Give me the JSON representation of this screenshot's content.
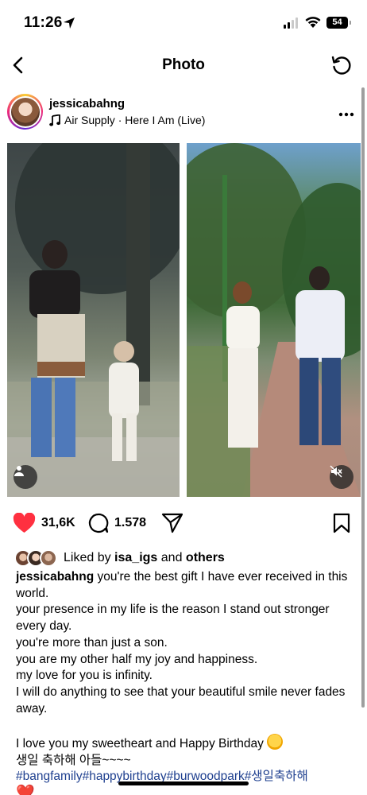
{
  "status_bar": {
    "time": "11:26",
    "battery": "54"
  },
  "nav": {
    "title": "Photo"
  },
  "post": {
    "username": "jessicabahng",
    "song": "Air Supply · Here I Am (Live)"
  },
  "actions": {
    "likes_count": "31,6K",
    "comments_count": "1.578"
  },
  "liked_by": {
    "prefix": "Liked by",
    "user": "isa_igs",
    "conj": "and",
    "others": "others"
  },
  "caption": {
    "username": "jessicabahng",
    "line1": " you're the best gift I have ever received in this world.",
    "line2": "your presence in my life is the reason I stand out stronger every day.",
    "line3": "you're more than just a son.",
    "line4": "you are my other half my joy and happiness.",
    "line5": "my love for you is infinity.",
    "line6": "I will do anything to see that your beautiful smile never fades away.",
    "line7": "I love you my sweetheart and Happy Birthday ",
    "line8": "생일 축하해 아들~~~~",
    "hashtags": "#bangfamily#happybirthday#burwoodpark#생일축하해",
    "heart": "❤️"
  },
  "colors": {
    "like_red": "#ff3040",
    "hashtag_blue": "#1e3f8f"
  },
  "icons": [
    "location-arrow-icon",
    "signal-icon",
    "wifi-icon",
    "back-icon",
    "refresh-icon",
    "music-note-icon",
    "more-icon",
    "heart-icon",
    "comment-icon",
    "share-icon",
    "bookmark-icon",
    "person-tag-icon",
    "mute-icon"
  ]
}
